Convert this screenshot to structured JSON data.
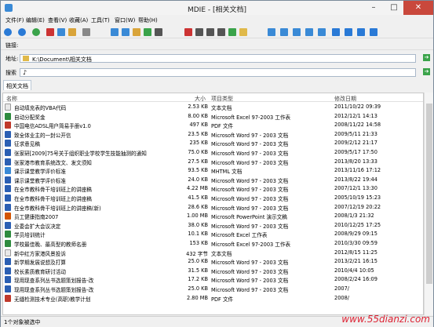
{
  "window": {
    "title": "MDIE - [相关文档]"
  },
  "menu": [
    "文件(F)",
    "编辑(E)",
    "查看(V)",
    "收藏(A)",
    "工具(T)",
    "窗口(W)",
    "帮助(H)"
  ],
  "bars": {
    "link_label": "链接:",
    "address_label": "地址:",
    "address_value": "K:\\Document\\相关文档",
    "search_label": "搜索"
  },
  "tab": "相关文档",
  "columns": [
    "名称",
    "大小",
    "项目类型",
    "修改日期"
  ],
  "files": [
    {
      "name": "自动填充表的VBA代码",
      "size": "2.53 KB",
      "type": "文本文档",
      "date": "2011/10/22 09:39",
      "icon": "txt"
    },
    {
      "name": "自动分配奖金",
      "size": "8.00 KB",
      "type": "Microsoft Excel 97-2003 工作表",
      "date": "2012/12/1 14:13",
      "icon": "xls"
    },
    {
      "name": "中国电信ADSL用户简易手册v1.0",
      "size": "497 KB",
      "type": "PDF 文件",
      "date": "2008/11/22 14:58",
      "icon": "pdf"
    },
    {
      "name": "致全体业主的一封公开信",
      "size": "23.5 KB",
      "type": "Microsoft Word 97 - 2003 文档",
      "date": "2009/5/11 21:33",
      "icon": "doc"
    },
    {
      "name": "征求意见稿",
      "size": "235 KB",
      "type": "Microsoft Word 97 - 2003 文档",
      "date": "2009/2/12 21:17",
      "icon": "doc"
    },
    {
      "name": "张家研[2009]75号关于组织职业学校学生技能抽测的通知",
      "size": "75.0 KB",
      "type": "Microsoft Word 97 - 2003 文档",
      "date": "2009/5/17 17:50",
      "icon": "doc"
    },
    {
      "name": "张家港市教育系统改文、发文须知",
      "size": "27.5 KB",
      "type": "Microsoft Word 97 - 2003 文档",
      "date": "2013/8/20 13:33",
      "icon": "doc"
    },
    {
      "name": "课示课堂教学评价标准",
      "size": "93.5 KB",
      "type": "MHTML 文档",
      "date": "2013/11/16 17:12",
      "icon": "mht"
    },
    {
      "name": "课示课堂教学评价标准",
      "size": "24.0 KB",
      "type": "Microsoft Word 97 - 2003 文档",
      "date": "2013/8/22 19:44",
      "icon": "doc"
    },
    {
      "name": "在全市教科骨干培训班上的讲座稿",
      "size": "4.22 MB",
      "type": "Microsoft Word 97 - 2003 文档",
      "date": "2007/12/1 13:30",
      "icon": "doc"
    },
    {
      "name": "在全市教科骨干培训班上的讲座稿",
      "size": "41.5 KB",
      "type": "Microsoft Word 97 - 2003 文档",
      "date": "2005/10/19 15:23",
      "icon": "doc"
    },
    {
      "name": "在全市教科骨干培训班上的讲座稿(新)",
      "size": "28.6 KB",
      "type": "Microsoft Word 97 - 2003 文档",
      "date": "2007/12/19 20:22",
      "icon": "doc"
    },
    {
      "name": "员工健康指南2007",
      "size": "1.00 MB",
      "type": "Microsoft PowerPoint 演示文稿",
      "date": "2008/1/3 21:32",
      "icon": "ppt"
    },
    {
      "name": "业委会扩大会议决定",
      "size": "38.0 KB",
      "type": "Microsoft Word 97 - 2003 文档",
      "date": "2010/12/25 17:25",
      "icon": "doc"
    },
    {
      "name": "学员培训统计",
      "size": "10.1 KB",
      "type": "Microsoft Excel 工作表",
      "date": "2008/9/29 09:15",
      "icon": "xls"
    },
    {
      "name": "学校最佳晚、最高型的教师名册",
      "size": "153 KB",
      "type": "Microsoft Excel 97-2003 工作表",
      "date": "2010/3/30 09:59",
      "icon": "xls"
    },
    {
      "name": "新中红方家港风景投诉",
      "size": "432 字节",
      "type": "文本文档",
      "date": "2012/8/15 11:25",
      "icon": "txt"
    },
    {
      "name": "新学期发展说想及打算",
      "size": "25.0 KB",
      "type": "Microsoft Word 97 - 2003 文档",
      "date": "2013/2/21 16:15",
      "icon": "doc"
    },
    {
      "name": "校长素质教育研讨活动",
      "size": "31.5 KB",
      "type": "Microsoft Word 97 - 2003 文档",
      "date": "2010/4/4 10:05",
      "icon": "doc"
    },
    {
      "name": "现用现查系列丛书选题策划报告-改",
      "size": "17.2 KB",
      "type": "Microsoft Word 97 - 2003 文档",
      "date": "2008/2/24 16:09",
      "icon": "doc"
    },
    {
      "name": "现用现查系列丛书选题策划报告-改",
      "size": "25.0 KB",
      "type": "Microsoft Word 97 - 2003 文档",
      "date": "2007/",
      "icon": "doc"
    },
    {
      "name": "无缝检测技术专业(高职)教学计划",
      "size": "2.80 MB",
      "type": "PDF 文件",
      "date": "2008/",
      "icon": "pdf"
    }
  ],
  "status": "1个对象被选中",
  "watermark": "www.55dianzi.com",
  "icon_colors": {
    "txt": "#e8e8e8",
    "xls": "#2e8b3e",
    "pdf": "#c0392b",
    "doc": "#2b5fb3",
    "mht": "#3a8ad6",
    "ppt": "#d35400"
  }
}
